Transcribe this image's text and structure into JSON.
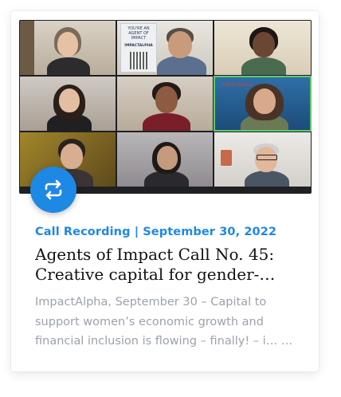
{
  "card": {
    "thumbnail": {
      "poster_line1": "YOU'RE AN AGENT OF IMPACT",
      "poster_line2": "IMPACTALPHA",
      "tile_watermark": "impactalpha",
      "active_speaker_color": "#62c86b"
    },
    "badge_icon": "repeat-icon",
    "meta": "Call Recording | September 30, 2022",
    "title": "Agents of Impact Call No. 45: Creative capital for gender-…",
    "excerpt": "ImpactAlpha, September 30 – Capital to support women’s economic growth and financial inclusion is flowing – finally! – i… …"
  },
  "colors": {
    "accent": "#1e88e5",
    "title": "#111111",
    "excerpt": "#9ba2ab"
  }
}
